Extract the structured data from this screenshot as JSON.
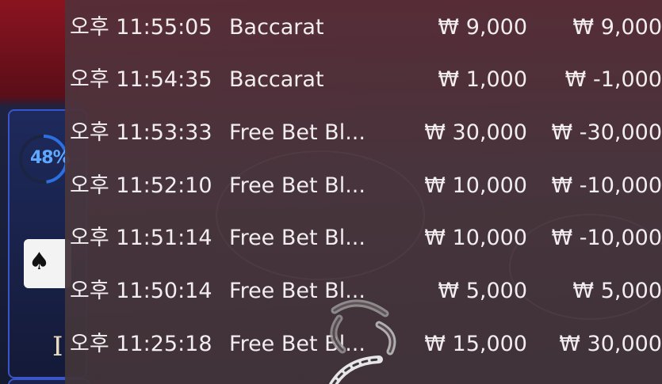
{
  "left_panel": {
    "progress_percent": 48,
    "progress_label": "48%",
    "card_suit": "♠",
    "partial_text": "I"
  },
  "history": {
    "rows": [
      {
        "time": "오후 11:55:05",
        "game": "Baccarat",
        "bet": "₩ 9,000",
        "result": "₩ 9,000"
      },
      {
        "time": "오후 11:54:35",
        "game": "Baccarat",
        "bet": "₩ 1,000",
        "result": "₩ -1,000"
      },
      {
        "time": "오후 11:53:33",
        "game": "Free Bet Bl...",
        "bet": "₩ 30,000",
        "result": "₩ -30,000"
      },
      {
        "time": "오후 11:52:10",
        "game": "Free Bet Bl...",
        "bet": "₩ 10,000",
        "result": "₩ -10,000"
      },
      {
        "time": "오후 11:51:14",
        "game": "Free Bet Bl...",
        "bet": "₩ 10,000",
        "result": "₩ -10,000"
      },
      {
        "time": "오후 11:50:14",
        "game": "Free Bet Bl...",
        "bet": "₩ 5,000",
        "result": "₩ 5,000"
      },
      {
        "time": "오후 11:25:18",
        "game": "Free Bet Bl...",
        "bet": "₩ 15,000",
        "result": "₩ 30,000"
      }
    ]
  },
  "colors": {
    "text": "#f2eef0",
    "accent_blue": "#3a55c8",
    "progress_blue": "#5fa8ff"
  },
  "icons": {
    "loading": "loading-spinner-icon",
    "card_suit": "spade-icon"
  }
}
